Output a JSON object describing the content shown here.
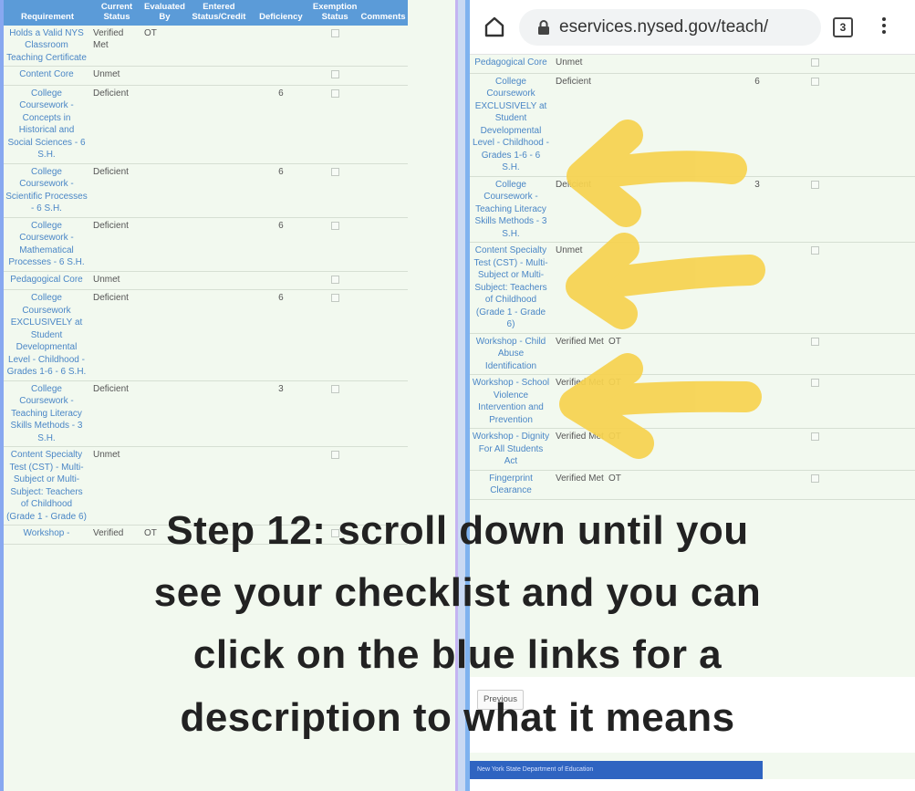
{
  "left_table": {
    "headers": [
      {
        "l1": "",
        "l2": "Requirement"
      },
      {
        "l1": "Current",
        "l2": "Status"
      },
      {
        "l1": "Evaluated",
        "l2": "By"
      },
      {
        "l1": "Entered",
        "l2": "Status/Credit"
      },
      {
        "l1": "",
        "l2": "Deficiency"
      },
      {
        "l1": "Exemption",
        "l2": "Status"
      },
      {
        "l1": "",
        "l2": "Comments"
      }
    ],
    "rows": [
      {
        "req": "Holds a Valid NYS Classroom Teaching Certificate",
        "status": "Verified Met",
        "by": "OT",
        "deficiency": ""
      },
      {
        "req": "Content Core",
        "status": "Unmet",
        "by": "",
        "deficiency": ""
      },
      {
        "req": "College Coursework - Concepts in Historical and Social Sciences - 6 S.H.",
        "status": "Deficient",
        "by": "",
        "deficiency": "6"
      },
      {
        "req": "College Coursework - Scientific Processes - 6 S.H.",
        "status": "Deficient",
        "by": "",
        "deficiency": "6"
      },
      {
        "req": "College Coursework - Mathematical Processes - 6 S.H.",
        "status": "Deficient",
        "by": "",
        "deficiency": "6"
      },
      {
        "req": "Pedagogical Core",
        "status": "Unmet",
        "by": "",
        "deficiency": ""
      },
      {
        "req": "College Coursework EXCLUSIVELY at Student Developmental Level - Childhood - Grades 1-6 - 6 S.H.",
        "status": "Deficient",
        "by": "",
        "deficiency": "6"
      },
      {
        "req": "College Coursework - Teaching Literacy Skills Methods - 3 S.H.",
        "status": "Deficient",
        "by": "",
        "deficiency": "3"
      },
      {
        "req": "Content Specialty Test (CST) - Multi-Subject or Multi-Subject: Teachers of Childhood (Grade 1 - Grade 6)",
        "status": "Unmet",
        "by": "",
        "deficiency": ""
      },
      {
        "req": "Workshop -",
        "status": "Verified",
        "by": "OT",
        "deficiency": ""
      }
    ]
  },
  "browser": {
    "url": "eservices.nysed.gov/teach/",
    "tab_count": "3"
  },
  "right_table": {
    "rows": [
      {
        "req": "Pedagogical Core",
        "status": "Unmet",
        "by": "",
        "deficiency": ""
      },
      {
        "req": "College Coursework EXCLUSIVELY at Student Developmental Level - Childhood - Grades 1-6 - 6 S.H.",
        "status": "Deficient",
        "by": "",
        "deficiency": "6"
      },
      {
        "req": "College Coursework - Teaching Literacy Skills Methods - 3 S.H.",
        "status": "Deficient",
        "by": "",
        "deficiency": "3"
      },
      {
        "req": "Content Specialty Test (CST) - Multi-Subject or Multi-Subject: Teachers of Childhood (Grade 1 - Grade 6)",
        "status": "Unmet",
        "by": "",
        "deficiency": ""
      },
      {
        "req": "Workshop - Child Abuse Identification",
        "status": "Verified Met",
        "by": "OT",
        "deficiency": ""
      },
      {
        "req": "Workshop - School Violence Intervention and Prevention",
        "status": "Verified Met",
        "by": "OT",
        "deficiency": ""
      },
      {
        "req": "Workshop - Dignity For All Students Act",
        "status": "Verified Met",
        "by": "OT",
        "deficiency": ""
      },
      {
        "req": "Fingerprint Clearance",
        "status": "Verified Met",
        "by": "OT",
        "deficiency": ""
      }
    ],
    "previous_label": "Previous",
    "footer": "New York State Department of Education"
  },
  "caption": {
    "line1": "Step 12: scroll down until you",
    "line2": "see your checklist and you can",
    "line3": "click on the blue links for a",
    "line4": "description to what it means"
  },
  "colors": {
    "arrow": "#f7d34f",
    "header": "#5b9bd8",
    "link": "#4a86c6",
    "footer": "#2f64c1"
  },
  "icons": [
    "home-icon",
    "lock-icon",
    "tabs-icon",
    "menu-icon",
    "checkbox-icon",
    "arrow-icon"
  ]
}
